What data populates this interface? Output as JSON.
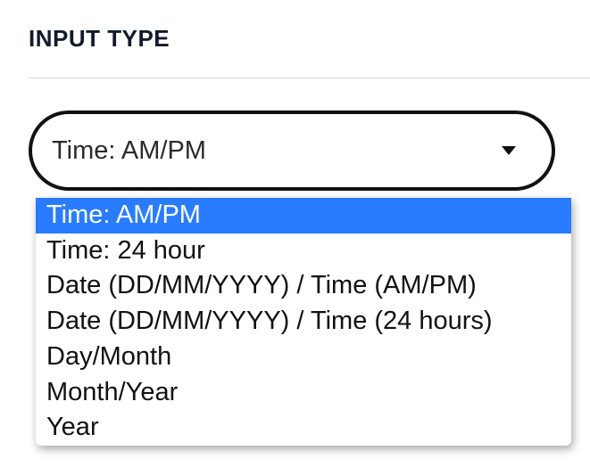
{
  "section": {
    "label": "INPUT TYPE"
  },
  "select": {
    "value": "Time: AM/PM",
    "options": [
      "Time: AM/PM",
      "Time: 24 hour",
      "Date (DD/MM/YYYY) / Time (AM/PM)",
      "Date (DD/MM/YYYY) / Time (24 hours)",
      "Day/Month",
      "Month/Year",
      "Year"
    ],
    "selected_index": 0
  }
}
